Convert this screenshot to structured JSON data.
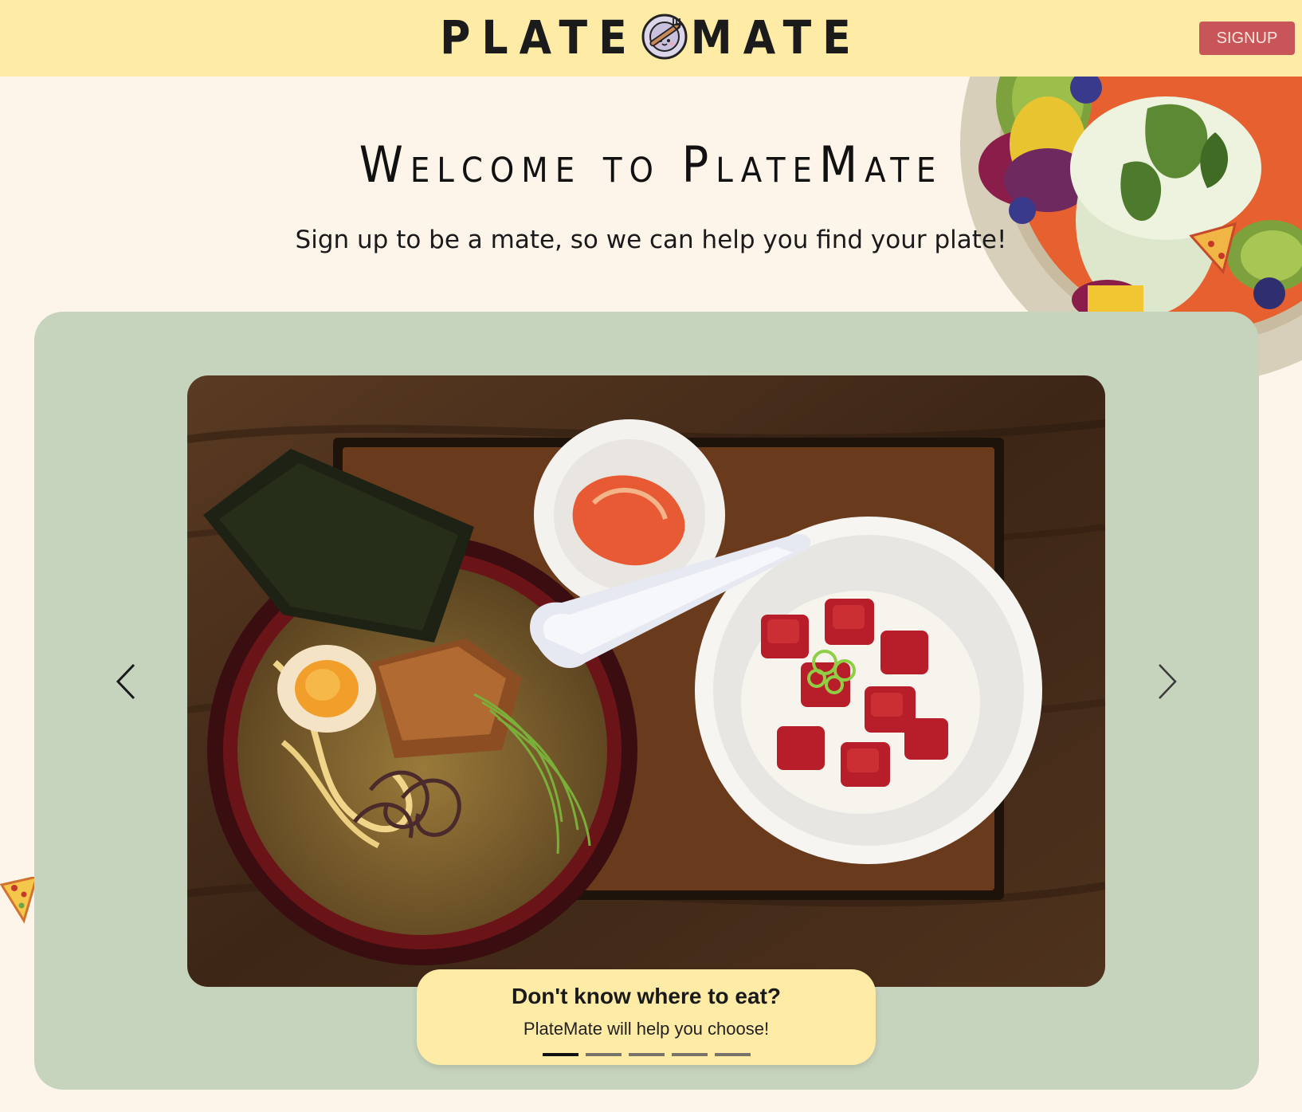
{
  "header": {
    "logo_left": "PLATE",
    "logo_right": "MATE",
    "signup_label": "SIGNUP"
  },
  "hero": {
    "title": "Welcome to PlateMate",
    "subtitle": "Sign up to be a mate, so we can help you find your plate!"
  },
  "carousel": {
    "slide_caption_title": "Don't know where to eat?",
    "slide_caption_text": "PlateMate will help you choose!",
    "active_slide": 1,
    "slide_count": 5,
    "prev_icon": "chevron-left-icon",
    "next_icon": "chevron-right-icon"
  },
  "colors": {
    "header_bg": "#fdeba6",
    "page_bg": "#fdf4ea",
    "panel_bg": "#c6d3bd",
    "signup_bg": "#c85557",
    "caption_bg": "#fdeba6"
  }
}
